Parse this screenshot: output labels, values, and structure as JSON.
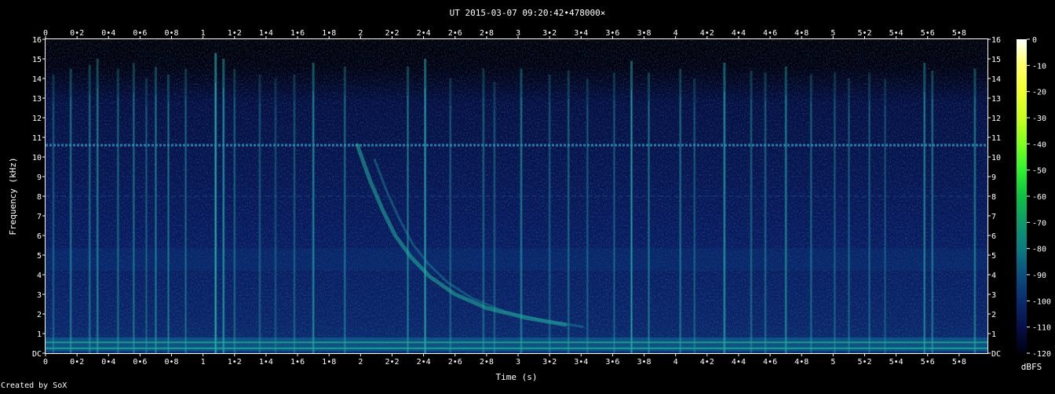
{
  "chart_data": {
    "type": "heatmap",
    "subtype": "spectrogram",
    "title": "UT 2015-03-07 09:20:42•478000×",
    "xlabel": "Time (s)",
    "ylabel": "Frequency (kHz)",
    "credit": "Created by SoX",
    "xlim": [
      0,
      5.98
    ],
    "ylim": [
      0,
      16
    ],
    "x_ticks": [
      {
        "v": 0,
        "label": "0"
      },
      {
        "v": 0.2,
        "label": "0•2"
      },
      {
        "v": 0.4,
        "label": "0•4"
      },
      {
        "v": 0.6,
        "label": "0•6"
      },
      {
        "v": 0.8,
        "label": "0•8"
      },
      {
        "v": 1,
        "label": "1"
      },
      {
        "v": 1.2,
        "label": "1•2"
      },
      {
        "v": 1.4,
        "label": "1•4"
      },
      {
        "v": 1.6,
        "label": "1•6"
      },
      {
        "v": 1.8,
        "label": "1•8"
      },
      {
        "v": 2,
        "label": "2"
      },
      {
        "v": 2.2,
        "label": "2•2"
      },
      {
        "v": 2.4,
        "label": "2•4"
      },
      {
        "v": 2.6,
        "label": "2•6"
      },
      {
        "v": 2.8,
        "label": "2•8"
      },
      {
        "v": 3,
        "label": "3"
      },
      {
        "v": 3.2,
        "label": "3•2"
      },
      {
        "v": 3.4,
        "label": "3•4"
      },
      {
        "v": 3.6,
        "label": "3•6"
      },
      {
        "v": 3.8,
        "label": "3•8"
      },
      {
        "v": 4,
        "label": "4"
      },
      {
        "v": 4.2,
        "label": "4•2"
      },
      {
        "v": 4.4,
        "label": "4•4"
      },
      {
        "v": 4.6,
        "label": "4•6"
      },
      {
        "v": 4.8,
        "label": "4•8"
      },
      {
        "v": 5,
        "label": "5"
      },
      {
        "v": 5.2,
        "label": "5•2"
      },
      {
        "v": 5.4,
        "label": "5•4"
      },
      {
        "v": 5.6,
        "label": "5•6"
      },
      {
        "v": 5.8,
        "label": "5•8"
      }
    ],
    "y_ticks": [
      {
        "v": 0,
        "label": "DC"
      },
      {
        "v": 1,
        "label": "1"
      },
      {
        "v": 2,
        "label": "2"
      },
      {
        "v": 3,
        "label": "3"
      },
      {
        "v": 4,
        "label": "4"
      },
      {
        "v": 5,
        "label": "5"
      },
      {
        "v": 6,
        "label": "6"
      },
      {
        "v": 7,
        "label": "7"
      },
      {
        "v": 8,
        "label": "8"
      },
      {
        "v": 9,
        "label": "9"
      },
      {
        "v": 10,
        "label": "10"
      },
      {
        "v": 11,
        "label": "11"
      },
      {
        "v": 12,
        "label": "12"
      },
      {
        "v": 13,
        "label": "13"
      },
      {
        "v": 14,
        "label": "14"
      },
      {
        "v": 15,
        "label": "15"
      },
      {
        "v": 16,
        "label": "16"
      }
    ],
    "colorbar": {
      "unit": "dBFS",
      "range": [
        -120,
        0
      ],
      "ticks": [
        "0",
        "-10",
        "-20",
        "-30",
        "-40",
        "-50",
        "-60",
        "-70",
        "-80",
        "-90",
        "-100",
        "-110",
        "-120"
      ],
      "stops": [
        "#ffffff",
        "#ffff66",
        "#f0ff30",
        "#c8ff20",
        "#80ff20",
        "#30f030",
        "#10c040",
        "#0e9a6a",
        "#0d7a80",
        "#0b4f7e",
        "#092c6c",
        "#060f48",
        "#000010"
      ]
    },
    "features": {
      "hum_line_khz": 10.6,
      "weak_line_khz": 8.0,
      "low_band_khz": [
        0.1,
        0.8
      ],
      "whistler": [
        {
          "t": 1.98,
          "f": 10.6
        },
        {
          "t": 2.06,
          "f": 8.8
        },
        {
          "t": 2.14,
          "f": 7.3
        },
        {
          "t": 2.22,
          "f": 6.0
        },
        {
          "t": 2.32,
          "f": 4.9
        },
        {
          "t": 2.44,
          "f": 3.9
        },
        {
          "t": 2.6,
          "f": 3.0
        },
        {
          "t": 2.8,
          "f": 2.3
        },
        {
          "t": 3.05,
          "f": 1.8
        },
        {
          "t": 3.3,
          "f": 1.45
        }
      ],
      "sferics": [
        {
          "t": 0.05,
          "fmax": 14.2,
          "a": 0.35
        },
        {
          "t": 0.16,
          "fmax": 14.5,
          "a": 0.5
        },
        {
          "t": 0.28,
          "fmax": 14.7,
          "a": 0.45
        },
        {
          "t": 0.33,
          "fmax": 15.0,
          "a": 0.55
        },
        {
          "t": 0.46,
          "fmax": 14.5,
          "a": 0.4
        },
        {
          "t": 0.56,
          "fmax": 14.8,
          "a": 0.45
        },
        {
          "t": 0.64,
          "fmax": 14.0,
          "a": 0.35
        },
        {
          "t": 0.7,
          "fmax": 14.6,
          "a": 0.5
        },
        {
          "t": 0.78,
          "fmax": 14.2,
          "a": 0.45
        },
        {
          "t": 0.89,
          "fmax": 14.5,
          "a": 0.4
        },
        {
          "t": 1.08,
          "fmax": 15.3,
          "a": 0.9
        },
        {
          "t": 1.13,
          "fmax": 15.0,
          "a": 0.7
        },
        {
          "t": 1.2,
          "fmax": 14.5,
          "a": 0.4
        },
        {
          "t": 1.36,
          "fmax": 14.2,
          "a": 0.35
        },
        {
          "t": 1.46,
          "fmax": 14.0,
          "a": 0.3
        },
        {
          "t": 1.58,
          "fmax": 14.2,
          "a": 0.35
        },
        {
          "t": 1.7,
          "fmax": 14.8,
          "a": 0.65
        },
        {
          "t": 1.9,
          "fmax": 14.6,
          "a": 0.45
        },
        {
          "t": 2.3,
          "fmax": 14.6,
          "a": 0.5
        },
        {
          "t": 2.41,
          "fmax": 15.0,
          "a": 0.75
        },
        {
          "t": 2.57,
          "fmax": 14.0,
          "a": 0.35
        },
        {
          "t": 2.78,
          "fmax": 14.5,
          "a": 0.4
        },
        {
          "t": 2.85,
          "fmax": 13.8,
          "a": 0.35
        },
        {
          "t": 3.02,
          "fmax": 14.5,
          "a": 0.55
        },
        {
          "t": 3.2,
          "fmax": 14.2,
          "a": 0.35
        },
        {
          "t": 3.32,
          "fmax": 14.4,
          "a": 0.4
        },
        {
          "t": 3.44,
          "fmax": 14.0,
          "a": 0.35
        },
        {
          "t": 3.61,
          "fmax": 14.3,
          "a": 0.35
        },
        {
          "t": 3.72,
          "fmax": 14.9,
          "a": 0.7
        },
        {
          "t": 3.83,
          "fmax": 14.3,
          "a": 0.45
        },
        {
          "t": 4.03,
          "fmax": 14.5,
          "a": 0.45
        },
        {
          "t": 4.12,
          "fmax": 14.0,
          "a": 0.35
        },
        {
          "t": 4.31,
          "fmax": 14.8,
          "a": 0.7
        },
        {
          "t": 4.48,
          "fmax": 14.4,
          "a": 0.4
        },
        {
          "t": 4.57,
          "fmax": 14.3,
          "a": 0.4
        },
        {
          "t": 4.7,
          "fmax": 14.6,
          "a": 0.6
        },
        {
          "t": 4.86,
          "fmax": 14.2,
          "a": 0.4
        },
        {
          "t": 5.01,
          "fmax": 14.3,
          "a": 0.35
        },
        {
          "t": 5.1,
          "fmax": 14.0,
          "a": 0.35
        },
        {
          "t": 5.23,
          "fmax": 14.3,
          "a": 0.35
        },
        {
          "t": 5.33,
          "fmax": 14.0,
          "a": 0.3
        },
        {
          "t": 5.58,
          "fmax": 14.8,
          "a": 0.6
        },
        {
          "t": 5.63,
          "fmax": 14.4,
          "a": 0.5
        },
        {
          "t": 5.9,
          "fmax": 14.5,
          "a": 0.55
        }
      ]
    }
  }
}
